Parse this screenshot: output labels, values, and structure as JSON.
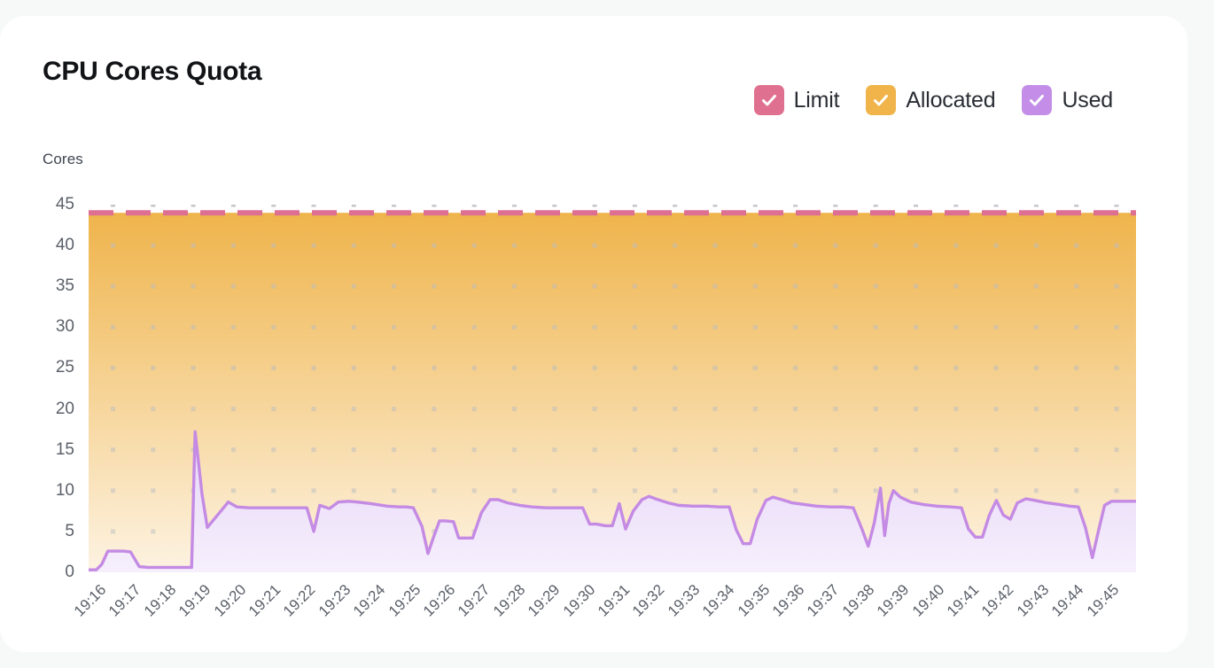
{
  "card": {
    "title": "CPU Cores Quota",
    "subtitle": "Cores"
  },
  "legend": {
    "position": "top-right",
    "items": [
      {
        "label": "Limit",
        "color": "#e07090",
        "icon": "checked-checkbox-icon",
        "checked": true
      },
      {
        "label": "Allocated",
        "color": "#f0b44a",
        "icon": "checked-checkbox-icon",
        "checked": true
      },
      {
        "label": "Used",
        "color": "#c48ee8",
        "icon": "checked-checkbox-icon",
        "checked": true
      }
    ]
  },
  "colors": {
    "limit_line": "#dd6f93",
    "allocated_area_top": "#efb44b",
    "allocated_area_bottom": "#fdf3e2",
    "used_line": "#c48ae4",
    "used_area_top": "#e6d6f7",
    "used_area_bottom": "#f6effc",
    "grid_dot": "#b9bcc2",
    "axis_text": "#5b6069",
    "card_bg": "#ffffff",
    "page_bg": "#f7f8f8"
  },
  "chart_data": {
    "type": "area",
    "title": "CPU Cores Quota",
    "subtitle": "Cores",
    "xlabel": "",
    "ylabel": "Cores",
    "ylim": [
      0,
      45
    ],
    "yticks": [
      0,
      5,
      10,
      15,
      20,
      25,
      30,
      35,
      40,
      45
    ],
    "grid": "dots",
    "legend_position": "top-right",
    "x": [
      "19:16",
      "19:17",
      "19:18",
      "19:19",
      "19:20",
      "19:21",
      "19:22",
      "19:23",
      "19:24",
      "19:25",
      "19:26",
      "19:27",
      "19:28",
      "19:29",
      "19:30",
      "19:31",
      "19:32",
      "19:33",
      "19:34",
      "19:35",
      "19:36",
      "19:37",
      "19:38",
      "19:39",
      "19:40",
      "19:41",
      "19:42",
      "19:43",
      "19:44",
      "19:45"
    ],
    "x_minutes_total": 30,
    "series": [
      {
        "name": "Limit",
        "style": "dashed-line",
        "color": "#dd6f93",
        "constant": 44,
        "values": [
          44,
          44,
          44,
          44,
          44,
          44,
          44,
          44,
          44,
          44,
          44,
          44,
          44,
          44,
          44,
          44,
          44,
          44,
          44,
          44,
          44,
          44,
          44,
          44,
          44,
          44,
          44,
          44,
          44,
          44
        ]
      },
      {
        "name": "Allocated",
        "style": "filled-area",
        "color": "#efb44b",
        "constant": 44,
        "values": [
          44,
          44,
          44,
          44,
          44,
          44,
          44,
          44,
          44,
          44,
          44,
          44,
          44,
          44,
          44,
          44,
          44,
          44,
          44,
          44,
          44,
          44,
          44,
          44,
          44,
          44,
          44,
          44,
          44,
          44
        ]
      },
      {
        "name": "Used",
        "style": "filled-area-line",
        "color": "#c48ae4",
        "points": [
          [
            0.0,
            0.3
          ],
          [
            0.22,
            0.3
          ],
          [
            0.38,
            1.0
          ],
          [
            0.55,
            2.6
          ],
          [
            0.8,
            2.6
          ],
          [
            1.0,
            2.6
          ],
          [
            1.2,
            2.5
          ],
          [
            1.45,
            0.7
          ],
          [
            1.7,
            0.6
          ],
          [
            2.1,
            0.6
          ],
          [
            2.5,
            0.6
          ],
          [
            2.8,
            0.6
          ],
          [
            2.95,
            0.6
          ],
          [
            3.05,
            17.2
          ],
          [
            3.25,
            9.5
          ],
          [
            3.4,
            5.5
          ],
          [
            3.75,
            7.3
          ],
          [
            4.0,
            8.6
          ],
          [
            4.25,
            8.0
          ],
          [
            4.6,
            7.9
          ],
          [
            5.1,
            7.9
          ],
          [
            5.6,
            7.9
          ],
          [
            6.05,
            7.9
          ],
          [
            6.25,
            7.9
          ],
          [
            6.45,
            5.0
          ],
          [
            6.62,
            8.2
          ],
          [
            6.9,
            7.8
          ],
          [
            7.15,
            8.6
          ],
          [
            7.45,
            8.7
          ],
          [
            7.7,
            8.6
          ],
          [
            8.1,
            8.4
          ],
          [
            8.55,
            8.1
          ],
          [
            8.9,
            8.0
          ],
          [
            9.1,
            8.0
          ],
          [
            9.3,
            7.9
          ],
          [
            9.55,
            5.6
          ],
          [
            9.72,
            2.3
          ],
          [
            9.88,
            4.3
          ],
          [
            10.05,
            6.3
          ],
          [
            10.22,
            6.3
          ],
          [
            10.45,
            6.2
          ],
          [
            10.6,
            4.2
          ],
          [
            10.8,
            4.2
          ],
          [
            11.0,
            4.2
          ],
          [
            11.25,
            7.3
          ],
          [
            11.5,
            8.9
          ],
          [
            11.72,
            8.9
          ],
          [
            12.0,
            8.5
          ],
          [
            12.35,
            8.2
          ],
          [
            12.7,
            8.0
          ],
          [
            13.1,
            7.9
          ],
          [
            13.5,
            7.9
          ],
          [
            13.85,
            7.9
          ],
          [
            14.15,
            7.9
          ],
          [
            14.35,
            5.9
          ],
          [
            14.55,
            5.9
          ],
          [
            14.8,
            5.7
          ],
          [
            15.0,
            5.7
          ],
          [
            15.2,
            8.4
          ],
          [
            15.38,
            5.3
          ],
          [
            15.6,
            7.5
          ],
          [
            15.85,
            8.9
          ],
          [
            16.05,
            9.3
          ],
          [
            16.3,
            8.9
          ],
          [
            16.6,
            8.5
          ],
          [
            16.9,
            8.2
          ],
          [
            17.3,
            8.1
          ],
          [
            17.7,
            8.1
          ],
          [
            18.05,
            8.0
          ],
          [
            18.35,
            8.0
          ],
          [
            18.55,
            5.2
          ],
          [
            18.75,
            3.5
          ],
          [
            18.95,
            3.5
          ],
          [
            19.15,
            6.5
          ],
          [
            19.4,
            8.8
          ],
          [
            19.6,
            9.2
          ],
          [
            19.85,
            8.9
          ],
          [
            20.15,
            8.5
          ],
          [
            20.5,
            8.3
          ],
          [
            20.85,
            8.1
          ],
          [
            21.25,
            8.0
          ],
          [
            21.6,
            8.0
          ],
          [
            21.9,
            7.9
          ],
          [
            22.15,
            5.3
          ],
          [
            22.33,
            3.2
          ],
          [
            22.5,
            6.0
          ],
          [
            22.68,
            10.3
          ],
          [
            22.8,
            4.5
          ],
          [
            22.92,
            8.4
          ],
          [
            23.05,
            10.0
          ],
          [
            23.25,
            9.2
          ],
          [
            23.55,
            8.6
          ],
          [
            23.9,
            8.3
          ],
          [
            24.3,
            8.1
          ],
          [
            24.7,
            8.0
          ],
          [
            25.0,
            7.9
          ],
          [
            25.2,
            5.3
          ],
          [
            25.4,
            4.3
          ],
          [
            25.6,
            4.3
          ],
          [
            25.8,
            7.0
          ],
          [
            26.0,
            8.8
          ],
          [
            26.2,
            7.0
          ],
          [
            26.4,
            6.5
          ],
          [
            26.6,
            8.5
          ],
          [
            26.85,
            9.0
          ],
          [
            27.1,
            8.8
          ],
          [
            27.45,
            8.5
          ],
          [
            27.8,
            8.3
          ],
          [
            28.1,
            8.1
          ],
          [
            28.35,
            8.0
          ],
          [
            28.55,
            5.5
          ],
          [
            28.75,
            1.8
          ],
          [
            28.92,
            5.0
          ],
          [
            29.1,
            8.2
          ],
          [
            29.3,
            8.7
          ],
          [
            29.6,
            8.7
          ],
          [
            30.0,
            8.7
          ]
        ]
      }
    ]
  }
}
